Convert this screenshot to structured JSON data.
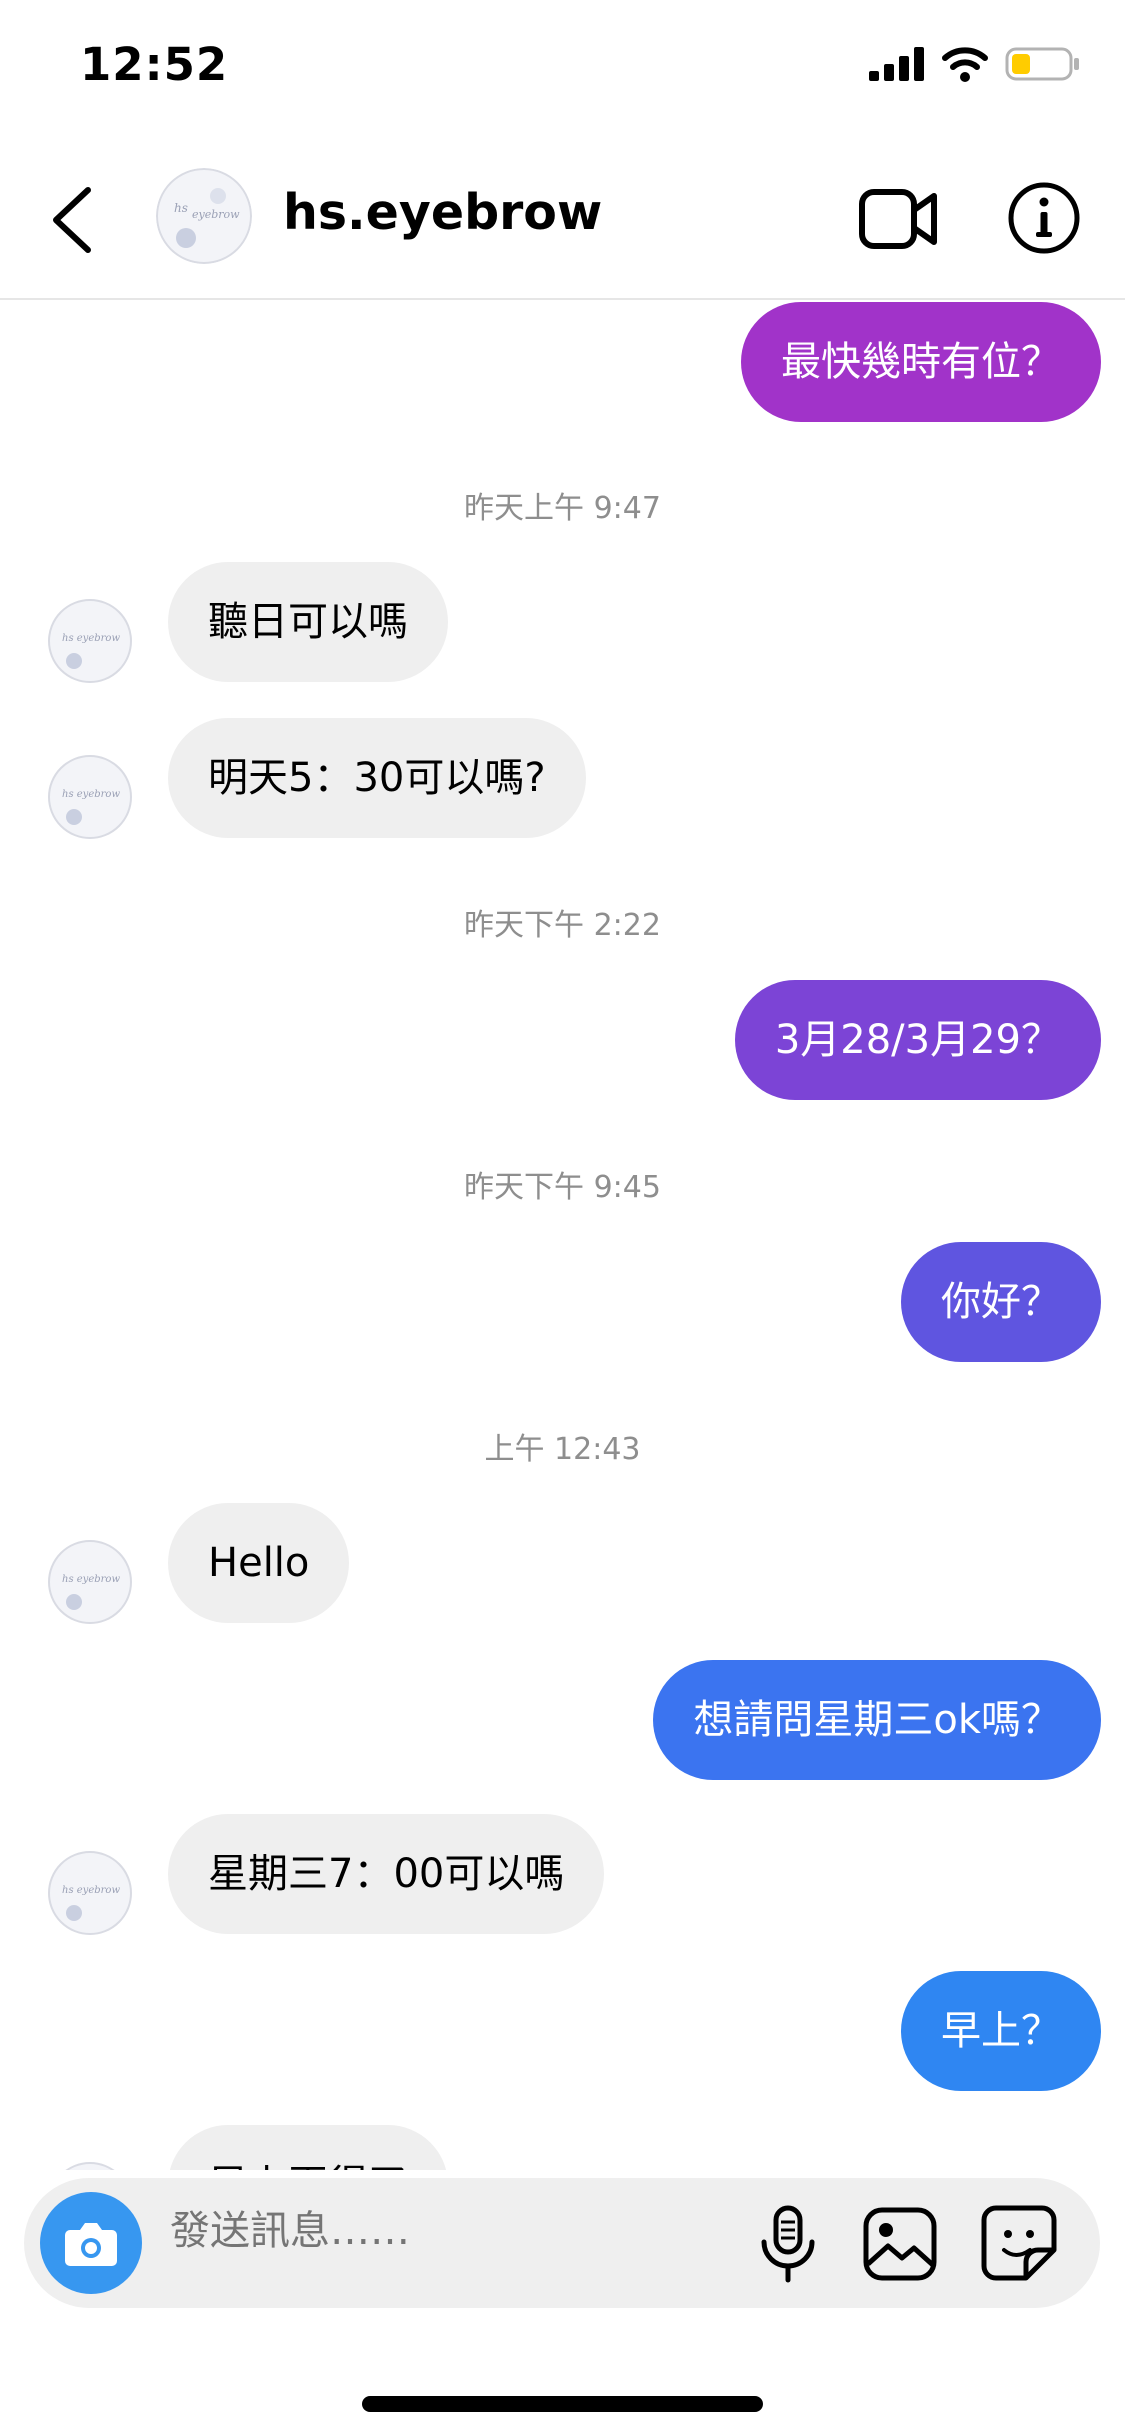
{
  "status_bar": {
    "time": "12:52"
  },
  "header": {
    "username": "hs.eyebrow",
    "avatar_text": "hs eyebrow"
  },
  "colors": {
    "incoming_bubble": "#efefef",
    "outgoing_gradient": [
      "#a133c9",
      "#7c44d6",
      "#5f55e0",
      "#4469ec",
      "#3b74f0",
      "#2f86f2"
    ],
    "camera_button": "#3797f0",
    "battery_fill": "#ffcc00"
  },
  "messages": [
    {
      "kind": "out",
      "text": "最快幾時有位？"
    },
    {
      "kind": "time",
      "text": "昨天上午 9:47"
    },
    {
      "kind": "in",
      "text": "聽日可以嗎"
    },
    {
      "kind": "in",
      "text": "明天5：30可以嗎?"
    },
    {
      "kind": "time",
      "text": "昨天下午 2:22"
    },
    {
      "kind": "out",
      "text": "3月28/3月29？"
    },
    {
      "kind": "time",
      "text": "昨天下午 9:45"
    },
    {
      "kind": "out",
      "text": "你好？"
    },
    {
      "kind": "time",
      "text": "上午 12:43"
    },
    {
      "kind": "in",
      "text": "Hello"
    },
    {
      "kind": "out",
      "text": "想請問星期三ok嗎？"
    },
    {
      "kind": "in",
      "text": "星期三7：00可以嗎"
    },
    {
      "kind": "out",
      "text": "早上？"
    },
    {
      "kind": "in",
      "text": "早上再得了"
    }
  ],
  "composer": {
    "placeholder": "發送訊息……"
  },
  "icons": {
    "back": "chevron-left-icon",
    "video": "video-camera-icon",
    "info": "info-circle-icon",
    "camera": "camera-icon",
    "mic": "microphone-icon",
    "image": "image-gallery-icon",
    "sticker": "sticker-icon"
  }
}
